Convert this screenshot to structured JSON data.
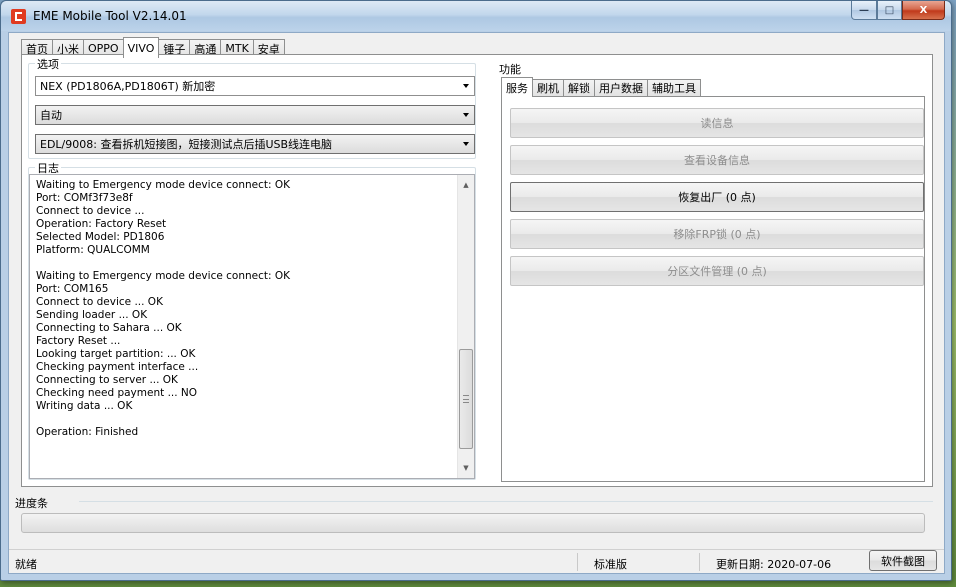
{
  "window": {
    "title": "EME Mobile Tool V2.14.01",
    "caption_minimize": "—",
    "caption_maximize": "□",
    "caption_close": "X"
  },
  "top_tabs": [
    {
      "label": "首页",
      "active": false
    },
    {
      "label": "小米",
      "active": false
    },
    {
      "label": "OPPO",
      "active": false
    },
    {
      "label": "VIVO",
      "active": true
    },
    {
      "label": "锤子",
      "active": false
    },
    {
      "label": "高通",
      "active": false
    },
    {
      "label": "MTK",
      "active": false
    },
    {
      "label": "安卓",
      "active": false
    }
  ],
  "options": {
    "group_title": "选项",
    "model_combo": "NEX (PD1806A,PD1806T) 新加密",
    "mode_combo": "自动",
    "method_combo": "EDL/9008: 查看拆机短接图，短接测试点后插USB线连电脑"
  },
  "log": {
    "group_title": "日志",
    "lines": [
      "Waiting to Emergency mode device connect: OK",
      "Port: COMf3f73e8f",
      "Connect to device ...",
      "Operation: Factory Reset",
      "Selected Model: PD1806",
      "Platform: QUALCOMM",
      "",
      "Waiting to Emergency mode device connect: OK",
      "Port: COM165",
      "Connect to device ... OK",
      "Sending loader ... OK",
      "Connecting to Sahara ... OK",
      "Factory Reset ...",
      "Looking target partition: ... OK",
      "Checking payment interface ...",
      "Connecting to server ... OK",
      "Checking need payment ... NO",
      "Writing data ... OK",
      "",
      "Operation: Finished"
    ]
  },
  "functions": {
    "group_title": "功能",
    "tabs": [
      {
        "label": "服务",
        "active": true
      },
      {
        "label": "刷机",
        "active": false
      },
      {
        "label": "解锁",
        "active": false
      },
      {
        "label": "用户数据",
        "active": false
      },
      {
        "label": "辅助工具",
        "active": false
      }
    ],
    "buttons": [
      {
        "label": "读信息",
        "enabled": false
      },
      {
        "label": "查看设备信息",
        "enabled": false
      },
      {
        "label": "恢复出厂 (0 点)",
        "enabled": true
      },
      {
        "label": "移除FRP锁 (0 点)",
        "enabled": false
      },
      {
        "label": "分区文件管理 (0 点)",
        "enabled": false
      }
    ]
  },
  "progress": {
    "title": "进度条",
    "value": 0
  },
  "status": {
    "left": "就绪",
    "edition": "标准版",
    "update_date": "更新日期: 2020-07-06",
    "screenshot_button": "软件截图"
  }
}
